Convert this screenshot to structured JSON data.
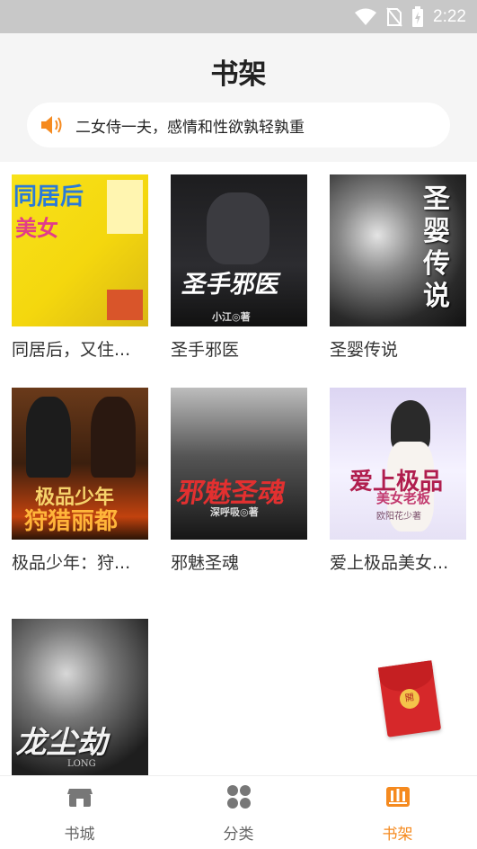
{
  "status_bar": {
    "time": "2:22"
  },
  "header": {
    "title": "书架"
  },
  "notice": {
    "text": "二女侍一夫，感情和性欲孰轻孰重"
  },
  "books": [
    {
      "title": "同居后，又住...",
      "cover_text": "同居后",
      "cover_sub": "美女"
    },
    {
      "title": "圣手邪医",
      "cover_text": "圣手邪医",
      "cover_author": "小江◎著"
    },
    {
      "title": "圣婴传说",
      "cover_text": "圣婴传说"
    },
    {
      "title": "极品少年：狩...",
      "cover_text": "极品少年",
      "cover_sub": "狩猎丽都"
    },
    {
      "title": "邪魅圣魂",
      "cover_text": "邪魅圣魂",
      "cover_author": "深呼吸◎著"
    },
    {
      "title": "爱上极品美女...",
      "cover_text": "爱上极品",
      "cover_sub": "美女老板",
      "cover_author": "欧阳花少著"
    },
    {
      "title": "",
      "cover_text": "龙尘劫",
      "cover_sub": "LONG"
    }
  ],
  "red_packet": {
    "seal": "開"
  },
  "bottom_nav": [
    {
      "label": "书城",
      "icon": "store-icon",
      "active": false
    },
    {
      "label": "分类",
      "icon": "category-grid-icon",
      "active": false
    },
    {
      "label": "书架",
      "icon": "bookshelf-icon",
      "active": true
    }
  ],
  "colors": {
    "accent": "#f58a1f",
    "header_bg": "#f5f5f5",
    "status_bar_bg": "#c8c8c8"
  }
}
